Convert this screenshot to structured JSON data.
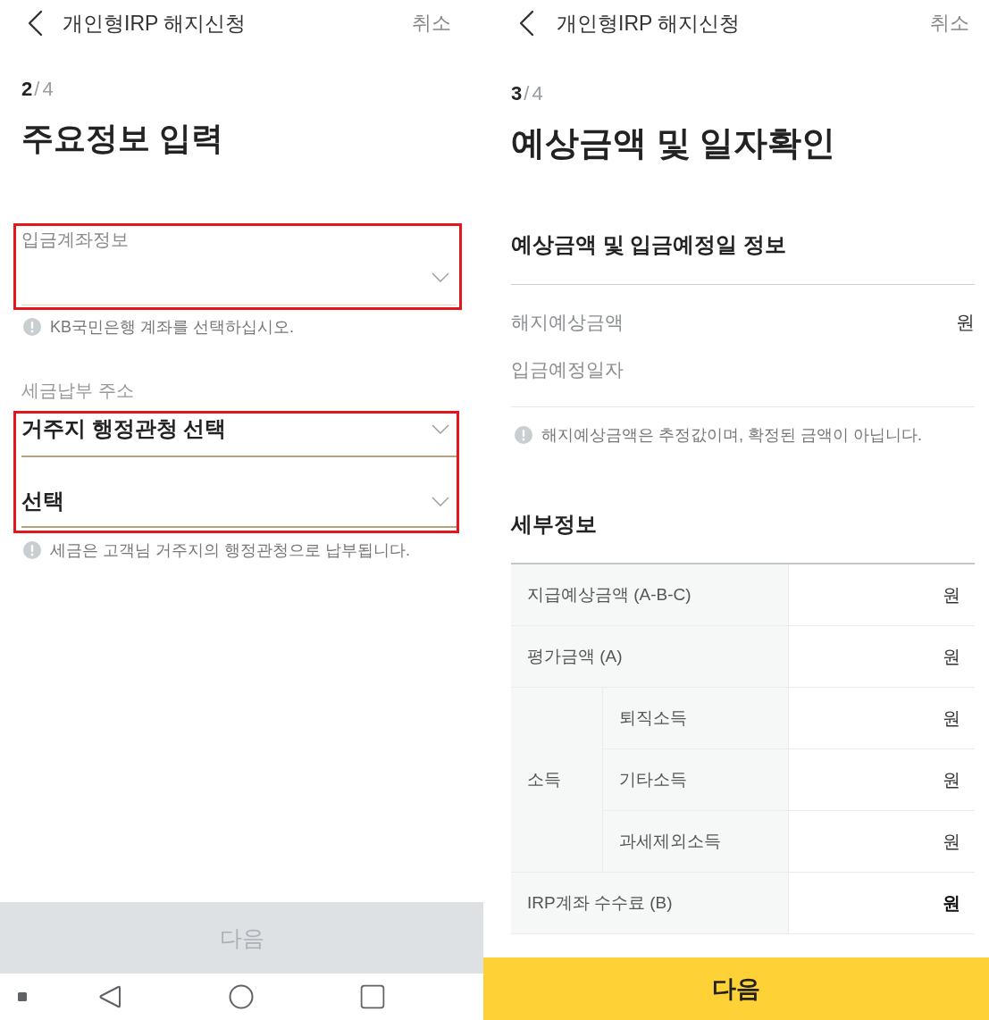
{
  "left_screen": {
    "header": {
      "title": "개인형IRP 해지신청",
      "cancel": "취소"
    },
    "step": {
      "current": "2",
      "separator": "/",
      "total": "4"
    },
    "title": "주요정보 입력",
    "account_field": {
      "label": "입금계좌정보",
      "highlighted": true,
      "notice": "KB국민은행 계좌를 선택하십시오."
    },
    "tax_address": {
      "label": "세금납부 주소",
      "highlighted": true,
      "selects": [
        {
          "value": "거주지 행정관청 선택"
        },
        {
          "value": "선택"
        }
      ],
      "notice": "세금은 고객님 거주지의 행정관청으로 납부됩니다."
    },
    "next_button": {
      "label": "다음",
      "disabled": true
    }
  },
  "right_screen": {
    "header": {
      "title": "개인형IRP 해지신청",
      "cancel": "취소"
    },
    "step": {
      "current": "3",
      "separator": "/",
      "total": "4"
    },
    "title": "예상금액 및 일자확인",
    "summary": {
      "heading": "예상금액 및 입금예정일 정보",
      "rows": [
        {
          "label": "해지예상금액",
          "value": "원"
        },
        {
          "label": "입금예정일자"
        }
      ],
      "notice": "해지예상금액은 추정값이며, 확정된 금액이 아닙니다."
    },
    "details": {
      "heading": "세부정보",
      "rows": [
        {
          "kind": "single",
          "label": "지급예상금액 (A-B-C)",
          "value": "원",
          "bold": false
        },
        {
          "kind": "single",
          "label": "평가금액 (A)",
          "value": "원",
          "bold": false
        },
        {
          "kind": "group",
          "label": "소득",
          "rows": [
            {
              "label": "퇴직소득",
              "value": "원",
              "bold": false
            },
            {
              "label": "기타소득",
              "value": "원",
              "bold": false
            },
            {
              "label": "과세제외소득",
              "value": "원",
              "bold": false
            }
          ]
        },
        {
          "kind": "single",
          "label": "IRP계좌 수수료 (B)",
          "value": "원",
          "bold": true
        }
      ]
    },
    "next_button": {
      "label": "다음",
      "disabled": false
    }
  }
}
